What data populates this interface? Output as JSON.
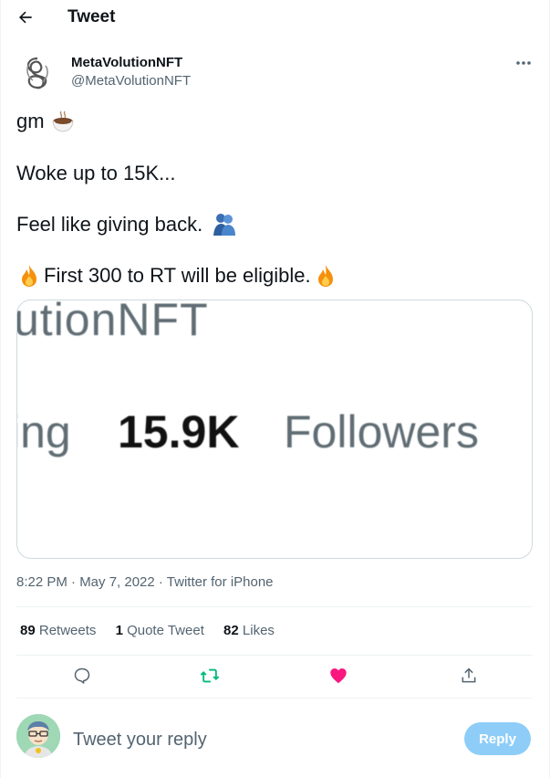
{
  "header": {
    "title": "Tweet"
  },
  "author": {
    "display_name": "MetaVolutionNFT",
    "handle": "@MetaVolutionNFT"
  },
  "tweet": {
    "lines": [
      {
        "text": "gm",
        "emoji_after": "coffee-cup-emoji"
      },
      {
        "text": "Woke up to 15K..."
      },
      {
        "text": "Feel like giving back.",
        "emoji_after": "people-hugging-emoji"
      },
      {
        "text": "First 300 to RT will be eligible.",
        "emoji_before": "fire-emoji",
        "emoji_after": "fire-emoji"
      }
    ],
    "media": {
      "line1": "utionNFT",
      "line2_prefix": "ing",
      "follower_count": "15.9K",
      "followers_label": "Followers"
    },
    "timestamp": "8:22 PM · May 7, 2022 · Twitter for iPhone"
  },
  "stats": {
    "retweets": {
      "count": "89",
      "label": "Retweets"
    },
    "quote_tweets": {
      "count": "1",
      "label": "Quote Tweet"
    },
    "likes": {
      "count": "82",
      "label": "Likes"
    }
  },
  "actions": [
    "reply-icon",
    "retweet-icon",
    "like-icon",
    "share-icon"
  ],
  "colors": {
    "retweet_active": "#00ba7c",
    "like_active": "#f91880",
    "reply_button": "#8ecdf8",
    "secondary_text": "#536471"
  },
  "reply": {
    "placeholder": "Tweet your reply",
    "button_label": "Reply"
  }
}
